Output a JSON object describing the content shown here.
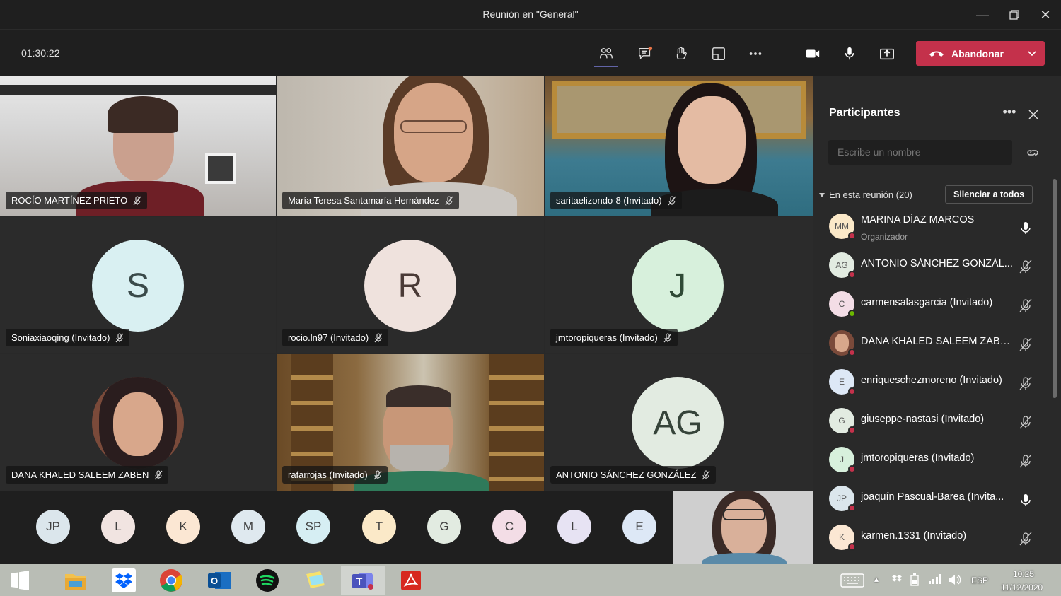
{
  "window": {
    "title": "Reunión en \"General\""
  },
  "toolbar": {
    "timer": "01:30:22",
    "leave_label": "Abandonar"
  },
  "tiles": [
    {
      "name": "ROCÍO MARTÍNEZ PRIETO"
    },
    {
      "name": "María Teresa Santamaría Hernández"
    },
    {
      "name": "saritaelizondo-8 (Invitado)"
    },
    {
      "name": "Soniaxiaoqing (Invitado)",
      "initials": "S"
    },
    {
      "name": "rocio.ln97 (Invitado)",
      "initials": "R"
    },
    {
      "name": "jmtoropiqueras (Invitado)",
      "initials": "J"
    },
    {
      "name": "DANA KHALED SALEEM ZABEN"
    },
    {
      "name": "rafarrojas (Invitado)"
    },
    {
      "name": "ANTONIO SÁNCHEZ GONZÁLEZ",
      "initials": "AG"
    }
  ],
  "overflow_avatars": [
    {
      "initials": "JP",
      "color": "#dbe6ec"
    },
    {
      "initials": "L",
      "color": "#f1e4e1"
    },
    {
      "initials": "K",
      "color": "#fbe7d3"
    },
    {
      "initials": "M",
      "color": "#dfe9ef"
    },
    {
      "initials": "SP",
      "color": "#d6eef3"
    },
    {
      "initials": "T",
      "color": "#fbe9c8"
    },
    {
      "initials": "G",
      "color": "#e2ebe1"
    },
    {
      "initials": "C",
      "color": "#f3dde6"
    },
    {
      "initials": "L",
      "color": "#e7e3f3"
    },
    {
      "initials": "E",
      "color": "#dde8f6"
    }
  ],
  "panel": {
    "title": "Participantes",
    "search_placeholder": "Escribe un nombre",
    "section_label": "En esta reunión (20)",
    "mute_all_label": "Silenciar a todos",
    "participants": [
      {
        "initials": "MM",
        "name": "MARINA DÍAZ MARCOS",
        "role": "Organizador",
        "mic": "on",
        "status": "red",
        "color": "#fbe9c8"
      },
      {
        "initials": "AG",
        "name": "ANTONIO SÁNCHEZ GONZÁL...",
        "mic": "off",
        "status": "red",
        "color": "#e2ebe1"
      },
      {
        "initials": "C",
        "name": "carmensalasgarcia (Invitado)",
        "mic": "off",
        "status": "green",
        "color": "#f3dde6"
      },
      {
        "initials": "",
        "name": "DANA KHALED SALEEM ZABEN",
        "mic": "off",
        "status": "red",
        "color": "#8a5a44"
      },
      {
        "initials": "E",
        "name": "enriqueschezmoreno (Invitado)",
        "mic": "off",
        "status": "red",
        "color": "#dde8f6"
      },
      {
        "initials": "G",
        "name": "giuseppe-nastasi (Invitado)",
        "mic": "off",
        "status": "red",
        "color": "#e2ebe1"
      },
      {
        "initials": "J",
        "name": "jmtoropiqueras (Invitado)",
        "mic": "off",
        "status": "red",
        "color": "#d7f0dc"
      },
      {
        "initials": "JP",
        "name": "joaquín Pascual-Barea (Invita...",
        "mic": "on",
        "status": "red",
        "color": "#dbe6ec"
      },
      {
        "initials": "K",
        "name": "karmen.1331 (Invitado)",
        "mic": "off",
        "status": "red",
        "color": "#fbe7d3"
      }
    ]
  },
  "taskbar": {
    "language": "ESP",
    "time": "10:25",
    "date": "11/12/2020"
  },
  "colors": {
    "leave": "#c4314b",
    "accent": "#6264a7"
  }
}
